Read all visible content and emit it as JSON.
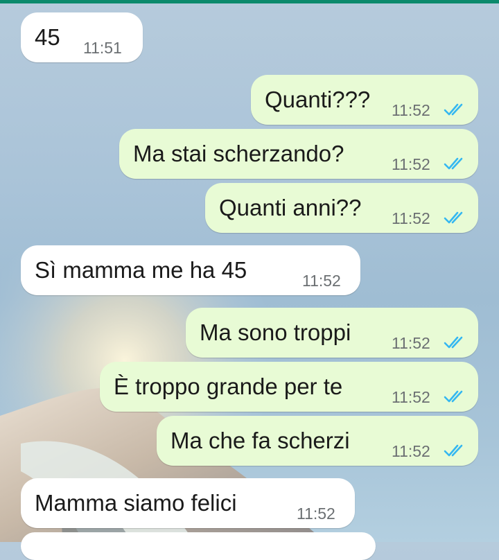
{
  "messages": [
    {
      "direction": "in",
      "text": "45",
      "time": "11:51"
    },
    {
      "direction": "out",
      "text": "Quanti???",
      "time": "11:52",
      "status": "read"
    },
    {
      "direction": "out",
      "text": "Ma stai scherzando?",
      "time": "11:52",
      "status": "read"
    },
    {
      "direction": "out",
      "text": "Quanti anni??",
      "time": "11:52",
      "status": "read"
    },
    {
      "direction": "in",
      "text": "Sì mamma me ha 45",
      "time": "11:52"
    },
    {
      "direction": "out",
      "text": "Ma sono troppi",
      "time": "11:52",
      "status": "read"
    },
    {
      "direction": "out",
      "text": "È troppo grande per te",
      "time": "11:52",
      "status": "read"
    },
    {
      "direction": "out",
      "text": "Ma che fa scherzi",
      "time": "11:52",
      "status": "read"
    },
    {
      "direction": "in",
      "text": "Mamma siamo felici",
      "time": "11:52"
    }
  ],
  "colors": {
    "outgoing_bubble": "#e8fbd5",
    "incoming_bubble": "#ffffff",
    "read_ticks": "#34b7f1",
    "header_accent": "#0c8a6c"
  },
  "icons": {
    "read_receipt": "double-check-icon"
  }
}
